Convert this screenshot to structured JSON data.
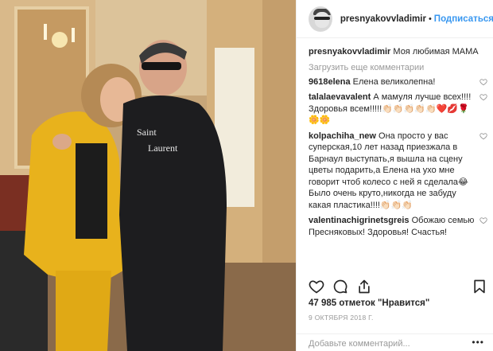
{
  "post": {
    "username": "presnyakovvladimir",
    "follow_label": "Подписаться",
    "dot": "•",
    "caption": "Моя любимая МАМА",
    "load_more": "Загрузить еще комментарии",
    "comments": [
      {
        "user": "9618elena",
        "text": "Елена великолепна!"
      },
      {
        "user": "talalaevavalent",
        "text": "А мамуля лучше всех!!!! Здоровья всем!!!!!👏🏻👏🏻👏🏻👏🏻👏🏻❤️💋🌹🌼🌼"
      },
      {
        "user": "kolpachiha_new",
        "text": "Она просто у вас суперская,10 лет назад приезжала в Барнаул выступать,я вышла на сцену цветы подарить,а Елена на ухо мне говорит чтоб колесо с ней я сделала😂 Было очень круто,никогда не забуду какая пластика!!!!👏🏻👏🏻👏🏻"
      },
      {
        "user": "valentinachigrinetsgreis",
        "text": "Обожаю семью Пресняковых! Здоровья! Счастья!"
      }
    ],
    "likes": "47 985 отметок \"Нравится\"",
    "date": "9 ОКТЯБРЯ 2018 Г.",
    "comment_placeholder": "Добавьте комментарий...",
    "more_label": "•••"
  },
  "icons": {
    "like": "heart-icon",
    "comment": "comment-icon",
    "share": "share-icon",
    "save": "bookmark-icon"
  },
  "colors": {
    "link": "#3897f0",
    "text": "#262626",
    "muted": "#999999",
    "divider": "#efefef"
  }
}
